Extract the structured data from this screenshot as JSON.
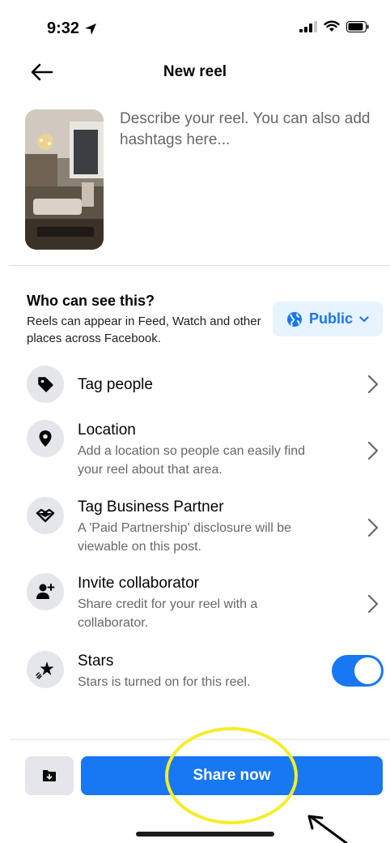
{
  "status_bar": {
    "time": "9:32"
  },
  "header": {
    "title": "New reel"
  },
  "composer": {
    "placeholder": "Describe your reel. You can also add hashtags here..."
  },
  "visibility": {
    "title": "Who can see this?",
    "subtitle": "Reels can appear in Feed, Watch and other places across Facebook.",
    "audience": "Public"
  },
  "options": [
    {
      "title": "Tag people",
      "subtitle": ""
    },
    {
      "title": "Location",
      "subtitle": "Add a location so people can easily find your reel about that area."
    },
    {
      "title": "Tag Business Partner",
      "subtitle": "A 'Paid Partnership' disclosure will be viewable on this post."
    },
    {
      "title": "Invite collaborator",
      "subtitle": "Share credit for your reel with a collaborator."
    },
    {
      "title": "Stars",
      "subtitle": "Stars is turned on for this reel.",
      "enabled": true
    }
  ],
  "actions": {
    "share_label": "Share now"
  },
  "colors": {
    "accent": "#1877f2",
    "annotation": "#f3ee2a"
  }
}
